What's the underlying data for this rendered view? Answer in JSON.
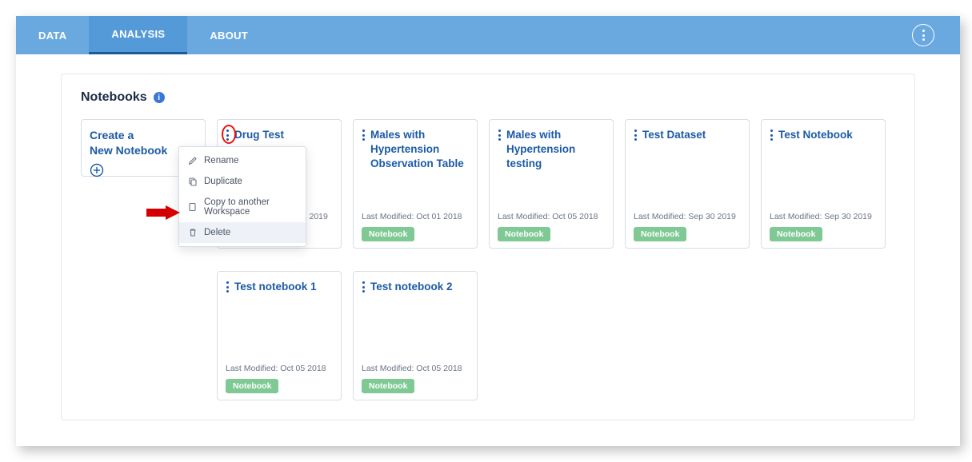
{
  "nav": {
    "tabs": [
      {
        "label": "DATA"
      },
      {
        "label": "ANALYSIS",
        "active": true
      },
      {
        "label": "ABOUT"
      }
    ]
  },
  "section": {
    "title": "Notebooks"
  },
  "create_card": {
    "line1": "Create a",
    "line2": "New Notebook"
  },
  "menu": {
    "rename": "Rename",
    "duplicate": "Duplicate",
    "copy": "Copy to another Workspace",
    "delete": "Delete"
  },
  "badge_text": "Notebook",
  "notebooks": [
    {
      "title": "Drug Test",
      "modified": "Last Modified: Sep 04 2019",
      "has_menu_open": true
    },
    {
      "title": "Males with Hypertension Observation Table",
      "modified": "Last Modified: Oct 01 2018"
    },
    {
      "title": "Males with Hypertension testing",
      "modified": "Last Modified: Oct 05 2018"
    },
    {
      "title": "Test Dataset",
      "modified": "Last Modified: Sep 30 2019"
    },
    {
      "title": "Test Notebook",
      "modified": "Last Modified: Sep 30 2019"
    },
    {
      "title": "Test notebook 1",
      "modified": "Last Modified: Oct 05 2018"
    },
    {
      "title": "Test notebook 2",
      "modified": "Last Modified: Oct 05 2018"
    }
  ]
}
